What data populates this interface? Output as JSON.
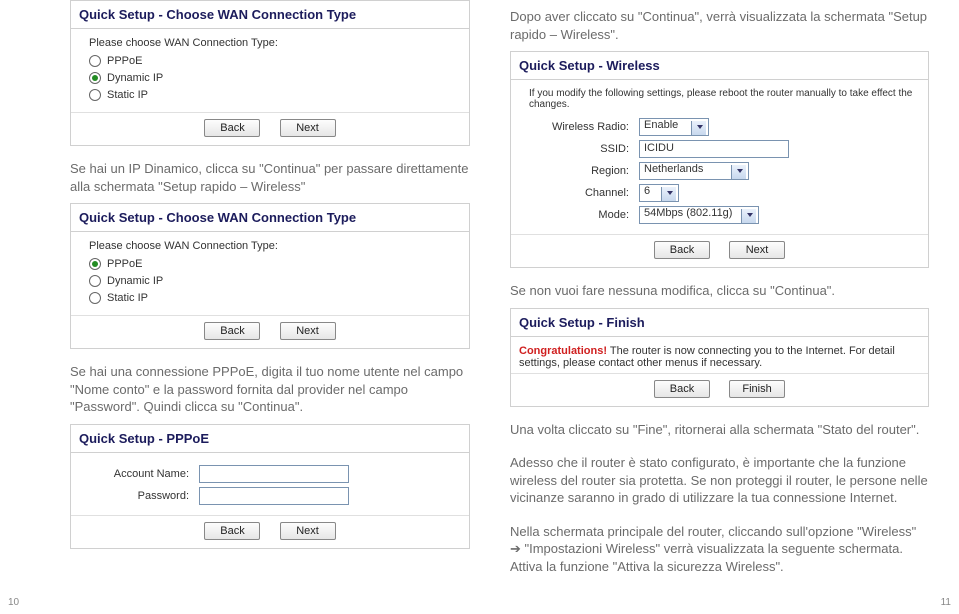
{
  "left": {
    "panel1": {
      "title": "Quick Setup - Choose WAN Connection Type",
      "prompt": "Please choose WAN Connection Type:",
      "options": [
        "PPPoE",
        "Dynamic IP",
        "Static IP"
      ],
      "selected": "Dynamic IP",
      "back": "Back",
      "next": "Next"
    },
    "para1": "Se hai un IP Dinamico, clicca su \"Continua\" per passare direttamente alla schermata \"Setup rapido – Wireless\"",
    "panel2": {
      "title": "Quick Setup - Choose WAN Connection Type",
      "prompt": "Please choose WAN Connection Type:",
      "options": [
        "PPPoE",
        "Dynamic IP",
        "Static IP"
      ],
      "selected": "PPPoE",
      "back": "Back",
      "next": "Next"
    },
    "para2": "Se hai una connessione PPPoE, digita il tuo nome utente nel campo \"Nome conto\" e la password fornita dal provider nel campo \"Password\". Quindi clicca su \"Continua\".",
    "panel3": {
      "title": "Quick Setup - PPPoE",
      "account_label": "Account Name:",
      "account_value": "",
      "password_label": "Password:",
      "password_value": "",
      "back": "Back",
      "next": "Next"
    }
  },
  "right": {
    "para1": "Dopo aver cliccato su \"Continua\", verrà visualizzata la schermata \"Setup rapido – Wireless\".",
    "panelW": {
      "title": "Quick Setup - Wireless",
      "note": "If you modify the following settings, please reboot the router manually to take effect the changes.",
      "radio_label": "Wireless Radio:",
      "radio_value": "Enable",
      "ssid_label": "SSID:",
      "ssid_value": "ICIDU",
      "region_label": "Region:",
      "region_value": "Netherlands",
      "channel_label": "Channel:",
      "channel_value": "6",
      "mode_label": "Mode:",
      "mode_value": "54Mbps (802.11g)",
      "back": "Back",
      "next": "Next"
    },
    "para2": "Se non vuoi fare nessuna modifica, clicca su \"Continua\".",
    "panelF": {
      "title": "Quick Setup - Finish",
      "congrats_bold": "Congratulations!",
      "congrats_rest": " The router is now connecting you to the Internet. For detail settings, please contact other menus if necessary.",
      "back": "Back",
      "finish": "Finish"
    },
    "para3": "Una volta cliccato su \"Fine\", ritornerai alla schermata \"Stato del router\".",
    "para4": "Adesso che il router è stato configurato, è importante che la funzione wireless del router sia protetta. Se non proteggi il router, le persone nelle vicinanze saranno in grado di utilizzare la tua connessione Internet.",
    "para5": "Nella schermata principale del router, cliccando sull'opzione \"Wireless\" ➔ \"Impostazioni Wireless\" verrà visualizzata la seguente schermata. Attiva la funzione \"Attiva la sicurezza Wireless\"."
  },
  "pagenums": {
    "left": "10",
    "right": "11"
  }
}
